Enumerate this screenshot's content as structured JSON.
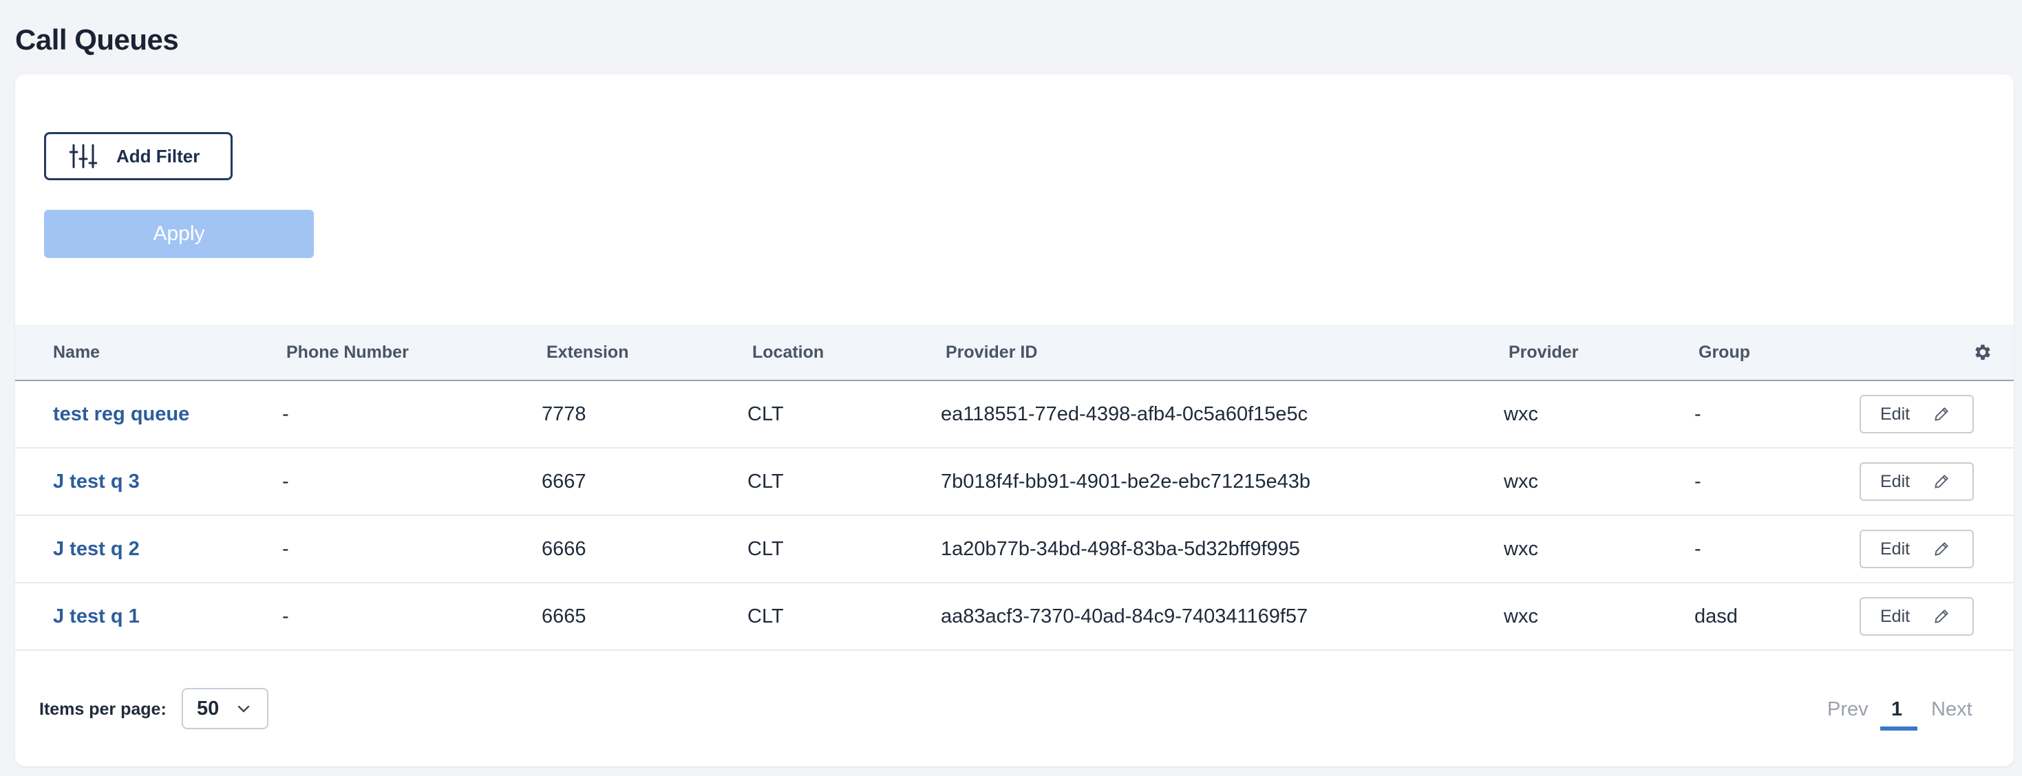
{
  "page": {
    "title": "Call Queues"
  },
  "filters": {
    "add_filter_label": "Add Filter",
    "apply_label": "Apply"
  },
  "table": {
    "columns": {
      "name": "Name",
      "phone_number": "Phone Number",
      "extension": "Extension",
      "location": "Location",
      "provider_id": "Provider ID",
      "provider": "Provider",
      "group": "Group"
    },
    "settings_icon": "gear-icon",
    "edit_label": "Edit",
    "edit_icon": "pencil-icon",
    "rows": [
      {
        "name": "test reg queue",
        "phone_number": "-",
        "extension": "7778",
        "location": "CLT",
        "provider_id": "ea118551-77ed-4398-afb4-0c5a60f15e5c",
        "provider": "wxc",
        "group": "-"
      },
      {
        "name": "J test q 3",
        "phone_number": "-",
        "extension": "6667",
        "location": "CLT",
        "provider_id": "7b018f4f-bb91-4901-be2e-ebc71215e43b",
        "provider": "wxc",
        "group": "-"
      },
      {
        "name": "J test q 2",
        "phone_number": "-",
        "extension": "6666",
        "location": "CLT",
        "provider_id": "1a20b77b-34bd-498f-83ba-5d32bff9f995",
        "provider": "wxc",
        "group": "-"
      },
      {
        "name": "J test q 1",
        "phone_number": "-",
        "extension": "6665",
        "location": "CLT",
        "provider_id": "aa83acf3-7370-40ad-84c9-740341169f57",
        "provider": "wxc",
        "group": "dasd"
      }
    ]
  },
  "pagination": {
    "items_per_page_label": "Items per page:",
    "items_per_page_value": "50",
    "prev_label": "Prev",
    "current_page": "1",
    "next_label": "Next"
  },
  "colors": {
    "link": "#2c5d9c",
    "apply_disabled": "#a1c4f5",
    "active_page_underline": "#3a78c9",
    "filter_border": "#233a5e"
  }
}
